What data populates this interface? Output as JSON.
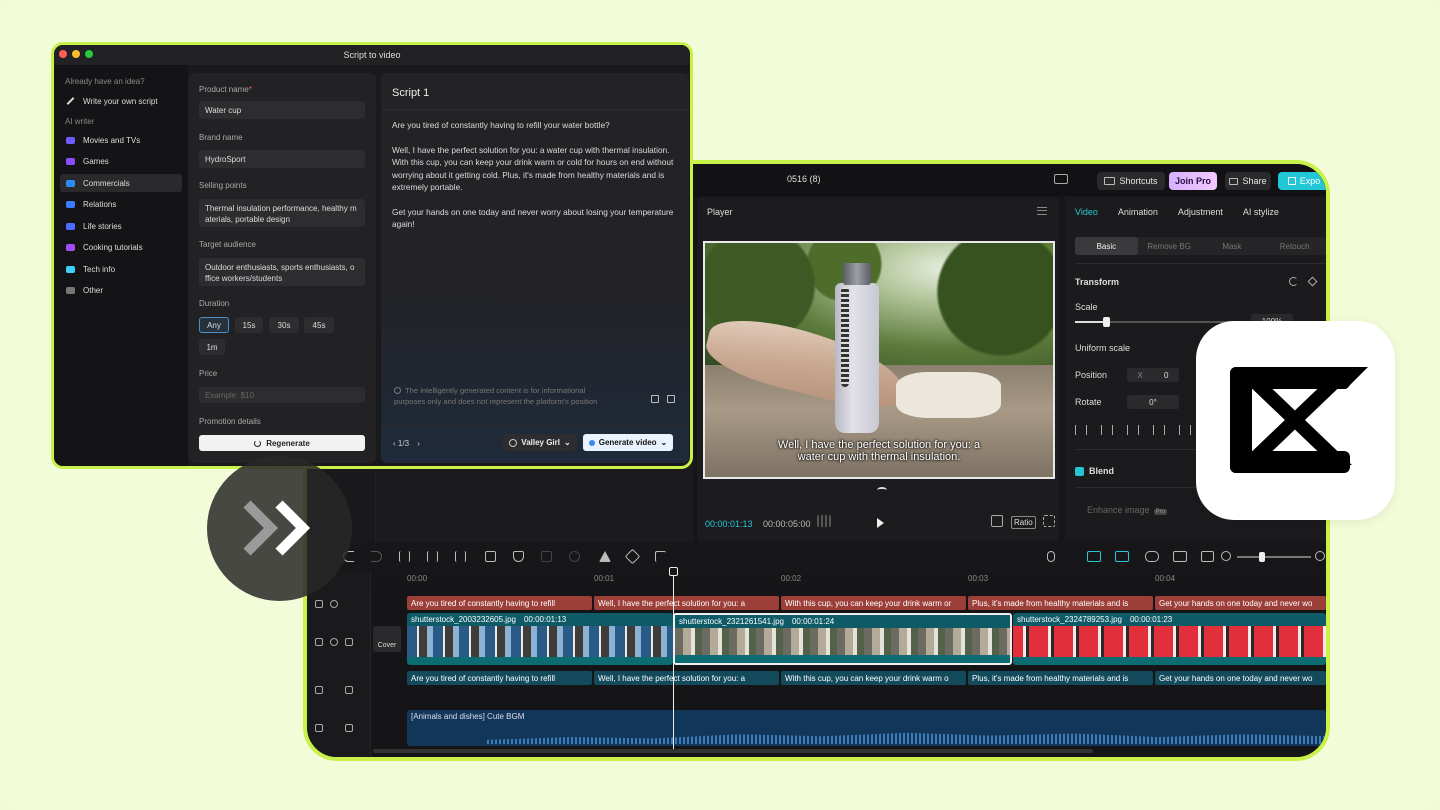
{
  "editor": {
    "project_title": "0516 (8)",
    "top_buttons": {
      "shortcuts": "Shortcuts",
      "join_pro": "Join Pro",
      "share": "Share",
      "export": "Expo"
    },
    "player": {
      "label": "Player",
      "subtitle_line1": "Well, I have the perfect solution for you: a",
      "subtitle_line2": "water cup with thermal insulation.",
      "current_time": "00:00:01:13",
      "total_time": "00:00:05:00",
      "ratio_label": "Ratio"
    },
    "inspector": {
      "tabs": [
        "Video",
        "Animation",
        "Adjustment",
        "AI stylize"
      ],
      "sub_tabs": [
        "Basic",
        "Remove BG",
        "Mask",
        "Retouch"
      ],
      "transform_label": "Transform",
      "scale_label": "Scale",
      "scale_value": "100%",
      "uniform_scale_label": "Uniform scale",
      "position_label": "Position",
      "position_x_label": "X",
      "position_x_value": "0",
      "rotate_label": "Rotate",
      "rotate_value": "0°",
      "blend_label": "Blend",
      "enhance_label": "Enhance image",
      "enhance_tag": "Pro"
    },
    "timeline": {
      "ruler": [
        "00:00",
        "00:01",
        "00:02",
        "00:03",
        "00:04"
      ],
      "cover_label": "Cover",
      "text_clips": [
        "Are you tired of constantly having to refill",
        "Well, I have the perfect solution for you: a",
        "With this cup, you can keep your drink warm or",
        "Plus, it's made from healthy materials and is",
        "Get your hands on one today and never wo"
      ],
      "video_clips": [
        {
          "name": "shutterstock_2003232605.jpg",
          "duration": "00:00:01:13"
        },
        {
          "name": "shutterstock_2321261541.jpg",
          "duration": "00:00:01:24"
        },
        {
          "name": "shutterstock_2324789253.jpg",
          "duration": "00:00:01:23"
        }
      ],
      "caption_clips": [
        "Are you tired of constantly having to refill",
        "Well, I have the perfect solution for you: a",
        "With this cup, you can keep your drink warm o",
        "Plus, it's made from healthy materials and is",
        "Get your hands on one today and never wo"
      ],
      "audio_label": "[Animals and dishes] Cute BGM"
    }
  },
  "script_window": {
    "title": "Script to video",
    "sidebar": {
      "section1": "Already have an idea?",
      "write_own": "Write your own script",
      "section2": "AI writer",
      "items": [
        "Movies and TVs",
        "Games",
        "Commercials",
        "Relations",
        "Life stories",
        "Cooking tutorials",
        "Tech info",
        "Other"
      ],
      "icon_colors": [
        "#6b5cff",
        "#8a4cff",
        "#2b8cff",
        "#3a7cff",
        "#4b6cff",
        "#a14cff",
        "#3bd0ff",
        "#777777"
      ]
    },
    "form": {
      "product_label": "Product name",
      "required_mark": "*",
      "product_value": "Water cup",
      "brand_label": "Brand name",
      "brand_value": "HydroSport",
      "selling_label": "Selling points",
      "selling_value": "Thermal insulation performance, healthy m aterials, portable design",
      "audience_label": "Target audience",
      "audience_value": "Outdoor enthusiasts, sports enthusiasts, o ffice workers/students",
      "duration_label": "Duration",
      "durations": [
        "Any",
        "15s",
        "30s",
        "45s",
        "1m"
      ],
      "price_label": "Price",
      "price_placeholder": "Example: $10",
      "promo_label": "Promotion details",
      "regenerate_label": "Regenerate"
    },
    "script": {
      "title": "Script 1",
      "paragraphs": [
        "Are you tired of constantly having to refill your water bottle?",
        "Well, I have the perfect solution for you: a water cup with thermal insulation. With this cup, you can keep your drink warm or cold for hours on end without worrying about it getting cold. Plus, it's made from healthy materials and is extremely portable.",
        "Get your hands on one today and never worry about losing your temperature again!"
      ],
      "disclaimer": "The intelligently generated content is for informational purposes only and does not represent the platform's position",
      "pager": "1/3",
      "voice_label": "Valley Girl",
      "generate_label": "Generate video"
    }
  },
  "colors": {
    "accent_lime": "#c8f24a",
    "accent_cyan": "#27c6d6",
    "background": "#f3fcd8"
  }
}
